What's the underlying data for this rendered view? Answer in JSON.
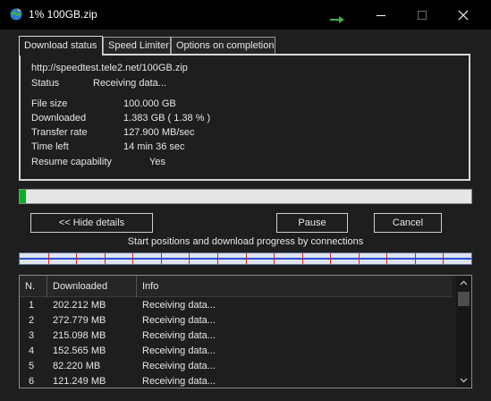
{
  "window": {
    "title": "1% 100GB.zip",
    "icons": {
      "app": "idm-globe-icon",
      "minimize": "minimize-icon",
      "maximize": "maximize-icon",
      "close": "close-icon",
      "tray": "tray-arrow-icon"
    }
  },
  "tabs": [
    {
      "label": "Download status",
      "active": true
    },
    {
      "label": "Speed Limiter",
      "active": false
    },
    {
      "label": "Options on completion",
      "active": false
    }
  ],
  "status": {
    "url": "http://speedtest.tele2.net/100GB.zip",
    "status_label": "Status",
    "status_value": "Receiving data...",
    "file_size_label": "File size",
    "file_size_value": "100.000  GB",
    "downloaded_label": "Downloaded",
    "downloaded_value": "1.383  GB  ( 1.38 % )",
    "transfer_rate_label": "Transfer rate",
    "transfer_rate_value": "127.900  MB/sec",
    "time_left_label": "Time left",
    "time_left_value": "14 min 36 sec",
    "resume_label": "Resume capability",
    "resume_value": "Yes"
  },
  "progress": {
    "percent": 1.38,
    "fill_color": "#06b025"
  },
  "buttons": {
    "hide_details": "<< Hide details",
    "pause": "Pause",
    "cancel": "Cancel"
  },
  "connections": {
    "caption": "Start positions and download progress by connections",
    "segment_count": 16,
    "line_color": "#2a4fd8",
    "marker_color": "#c62828"
  },
  "table": {
    "headers": [
      "N.",
      "Downloaded",
      "Info"
    ],
    "rows": [
      {
        "n": "1",
        "downloaded": "202.212  MB",
        "info": "Receiving data..."
      },
      {
        "n": "2",
        "downloaded": "272.779  MB",
        "info": "Receiving data..."
      },
      {
        "n": "3",
        "downloaded": "215.098  MB",
        "info": "Receiving data..."
      },
      {
        "n": "4",
        "downloaded": "152.565  MB",
        "info": "Receiving data..."
      },
      {
        "n": "5",
        "downloaded": "82.220  MB",
        "info": "Receiving data..."
      },
      {
        "n": "6",
        "downloaded": "121.249  MB",
        "info": "Receiving data..."
      }
    ]
  }
}
